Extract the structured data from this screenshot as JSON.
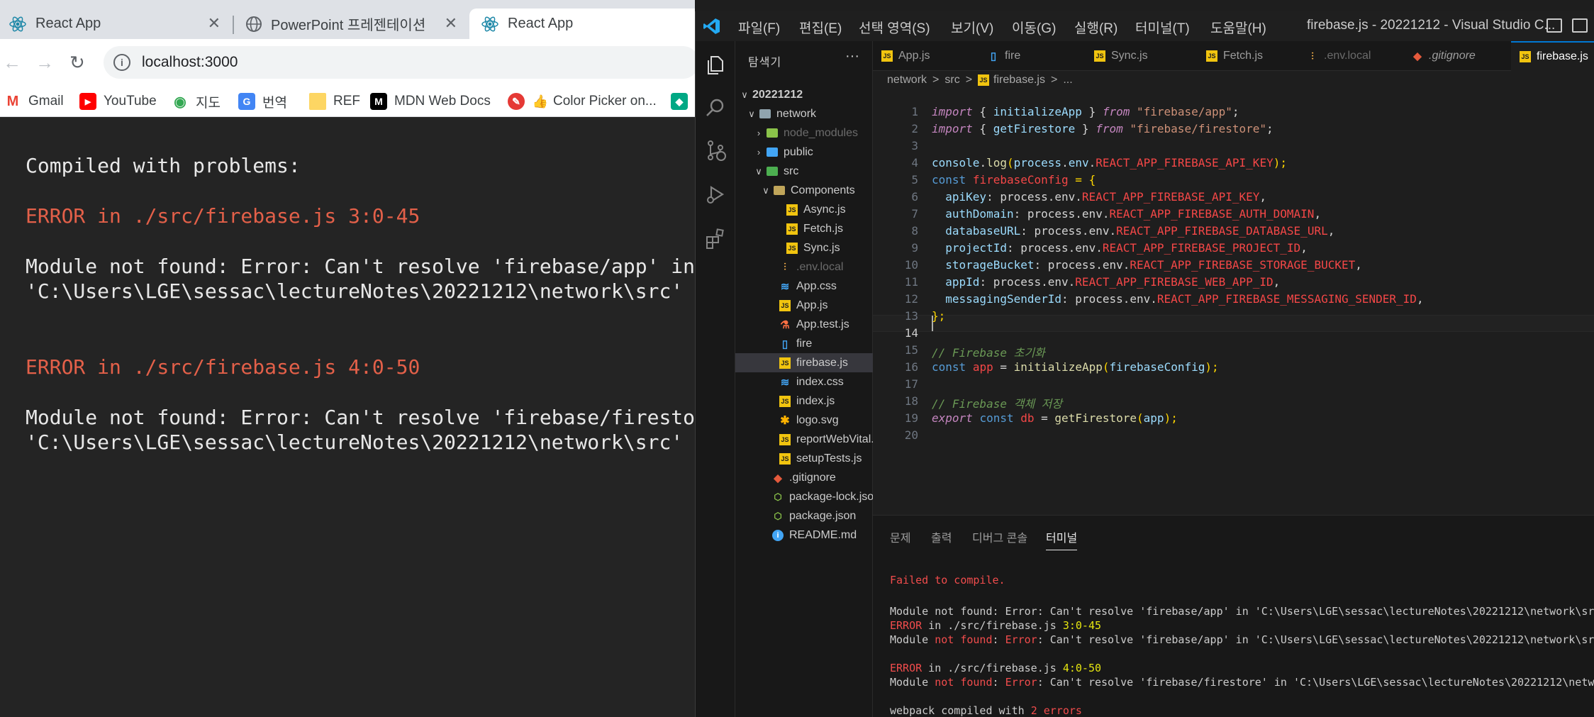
{
  "browser": {
    "tabs": [
      {
        "title": "React App"
      },
      {
        "title": "PowerPoint 프레젠테이션"
      },
      {
        "title": "React App"
      }
    ],
    "url": "localhost:3000",
    "bookmarks": [
      {
        "label": "Gmail"
      },
      {
        "label": "YouTube"
      },
      {
        "label": "지도"
      },
      {
        "label": "번역"
      },
      {
        "label": "REF"
      },
      {
        "label": "MDN Web Docs"
      },
      {
        "label": "Color Picker on..."
      }
    ],
    "overlay": {
      "heading": "Compiled with problems:",
      "errors": [
        {
          "title": "ERROR in ./src/firebase.js 3:0-45",
          "line1": "Module not found: Error: Can't resolve 'firebase/app' in",
          "line2": "'C:\\Users\\LGE\\sessac\\lectureNotes\\20221212\\network\\src'"
        },
        {
          "title": "ERROR in ./src/firebase.js 4:0-50",
          "line1": "Module not found: Error: Can't resolve 'firebase/firestore' in",
          "line2": "'C:\\Users\\LGE\\sessac\\lectureNotes\\20221212\\network\\src'"
        }
      ]
    }
  },
  "vscode": {
    "menu": [
      "파일(F)",
      "편집(E)",
      "선택 영역(S)",
      "보기(V)",
      "이동(G)",
      "실행(R)",
      "터미널(T)",
      "도움말(H)"
    ],
    "window_title": "firebase.js - 20221212 - Visual Studio C...",
    "explorer": {
      "header": "탐색기",
      "more": "···",
      "items": [
        {
          "label": "20221212",
          "chevron": "∨"
        },
        {
          "label": "network",
          "chevron": "∨"
        },
        {
          "label": "node_modules",
          "chevron": "›"
        },
        {
          "label": "public",
          "chevron": "›"
        },
        {
          "label": "src",
          "chevron": "∨"
        },
        {
          "label": "Components",
          "chevron": "∨"
        },
        {
          "label": "Async.js"
        },
        {
          "label": "Fetch.js"
        },
        {
          "label": "Sync.js"
        },
        {
          "label": ".env.local"
        },
        {
          "label": "App.css"
        },
        {
          "label": "App.js"
        },
        {
          "label": "App.test.js"
        },
        {
          "label": "fire"
        },
        {
          "label": "firebase.js"
        },
        {
          "label": "index.css"
        },
        {
          "label": "index.js"
        },
        {
          "label": "logo.svg"
        },
        {
          "label": "reportWebVital..."
        },
        {
          "label": "setupTests.js"
        },
        {
          "label": ".gitignore"
        },
        {
          "label": "package-lock.json"
        },
        {
          "label": "package.json"
        },
        {
          "label": "README.md"
        }
      ]
    },
    "tabs": [
      {
        "label": "App.js"
      },
      {
        "label": "fire"
      },
      {
        "label": "Sync.js"
      },
      {
        "label": "Fetch.js"
      },
      {
        "label": ".env.local"
      },
      {
        "label": ".gitignore"
      },
      {
        "label": "firebase.js"
      }
    ],
    "breadcrumb": {
      "part1": "network",
      "sep": ">",
      "part2": "src",
      "part3": "firebase.js",
      "part4": "..."
    },
    "line_numbers": [
      "1",
      "2",
      "3",
      "4",
      "5",
      "6",
      "7",
      "8",
      "9",
      "10",
      "11",
      "12",
      "13",
      "14",
      "15",
      "16",
      "17",
      "18",
      "19",
      "20"
    ],
    "current_line": "14",
    "code": {
      "l1": {
        "a": "import",
        "b": " { ",
        "c": "initializeApp",
        "d": " } ",
        "e": "from",
        "f": " ",
        "g": "\"firebase/app\"",
        "h": ";"
      },
      "l2": {
        "a": "import",
        "b": " { ",
        "c": "getFirestore",
        "d": " } ",
        "e": "from",
        "f": " ",
        "g": "\"firebase/firestore\"",
        "h": ";"
      },
      "l4": {
        "a": "console",
        "b": ".",
        "c": "log",
        "d": "(",
        "e": "process",
        "f": ".",
        "g": "env",
        "h": ".",
        "i": "REACT_APP_FIREBASE_API_KEY",
        "j": ");"
      },
      "l5": {
        "a": "const",
        "b": " ",
        "c": "firebaseConfig",
        "d": " = {"
      },
      "config": [
        {
          "key": "apiKey",
          "env": "REACT_APP_FIREBASE_API_KEY"
        },
        {
          "key": "authDomain",
          "env": "REACT_APP_FIREBASE_AUTH_DOMAIN"
        },
        {
          "key": "databaseURL",
          "env": "REACT_APP_FIREBASE_DATABASE_URL"
        },
        {
          "key": "projectId",
          "env": "REACT_APP_FIREBASE_PROJECT_ID"
        },
        {
          "key": "storageBucket",
          "env": "REACT_APP_FIREBASE_STORAGE_BUCKET"
        },
        {
          "key": "appId",
          "env": "REACT_APP_FIREBASE_WEB_APP_ID"
        },
        {
          "key": "messagingSenderId",
          "env": "REACT_APP_FIREBASE_MESSAGING_SENDER_ID"
        }
      ],
      "config_mid": ": process.env.",
      "l13": "};",
      "l15": "// Firebase 초기화",
      "l16": {
        "a": "const",
        "b": " ",
        "c": "app",
        "d": " = ",
        "e": "initializeApp",
        "f": "(",
        "g": "firebaseConfig",
        "h": ");"
      },
      "l18": "// Firebase 객체 저장",
      "l19": {
        "a": "export",
        "b": " ",
        "c": "const",
        "d": " ",
        "e": "db",
        "f": " = ",
        "g": "getFirestore",
        "h": "(",
        "i": "app",
        "j": ");"
      }
    },
    "panel": {
      "tabs": [
        "문제",
        "출력",
        "디버그 콘솔",
        "터미널"
      ],
      "t1": "Failed to compile.",
      "t2": "Module not found: Error: Can't resolve 'firebase/app' in 'C:\\Users\\LGE\\sessac\\lectureNotes\\20221212\\network\\src'",
      "t3a": "ERROR",
      "t3b": " in ./src/firebase.js ",
      "t3c": "3:0-45",
      "t4a": "Module ",
      "t4b": "not found",
      "t4c": ": ",
      "t4d": "Error",
      "t4e": ": Can't resolve 'firebase/app' in 'C:\\Users\\LGE\\sessac\\lectureNotes\\20221212\\network\\src'",
      "t5a": "ERROR",
      "t5b": " in ./src/firebase.js ",
      "t5c": "4:0-50",
      "t6a": "Module ",
      "t6b": "not found",
      "t6c": ": ",
      "t6d": "Error",
      "t6e": ": Can't resolve 'firebase/firestore' in 'C:\\Users\\LGE\\sessac\\lectureNotes\\20221212\\network\\src'",
      "t7a": "webpack compiled with ",
      "t7b": "2 errors"
    }
  }
}
